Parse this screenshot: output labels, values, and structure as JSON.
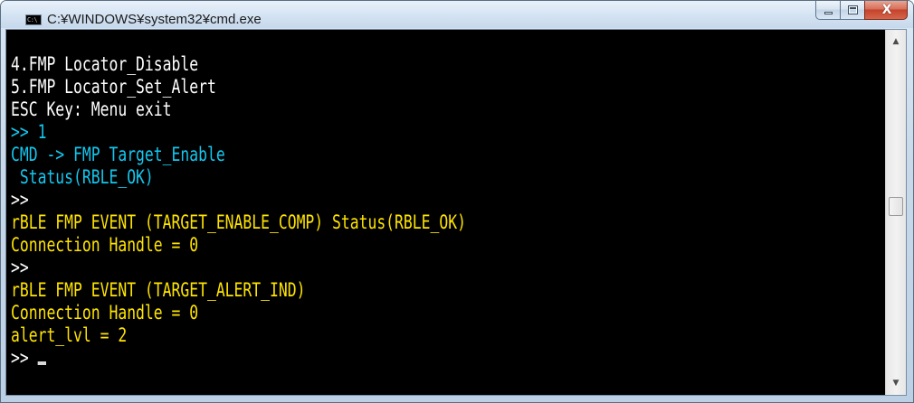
{
  "window": {
    "title": "C:¥WINDOWS¥system32¥cmd.exe",
    "icon": "cmd-console-icon",
    "icon_text": "C:\\",
    "controls": {
      "minimize_icon": "minimize-icon",
      "maximize_icon": "maximize-icon",
      "close_icon": "close-icon",
      "close_label": "X"
    }
  },
  "colors": {
    "background": "#000000",
    "white": "#ffffff",
    "cyan": "#13c8f0",
    "yellow": "#ffe400"
  },
  "console": {
    "lines": [
      {
        "text": "4.FMP Locator_Disable",
        "color": "white"
      },
      {
        "text": "5.FMP Locator_Set_Alert",
        "color": "white"
      },
      {
        "text": "ESC Key: Menu exit",
        "color": "white"
      },
      {
        "text": ">> 1",
        "color": "cyan"
      },
      {
        "text": "CMD -> FMP Target_Enable",
        "color": "cyan"
      },
      {
        "text": " Status(RBLE_OK)",
        "color": "cyan"
      },
      {
        "text": ">>",
        "color": "white"
      },
      {
        "text": "rBLE FMP EVENT (TARGET_ENABLE_COMP) Status(RBLE_OK)",
        "color": "yellow"
      },
      {
        "text": "Connection Handle = 0",
        "color": "yellow"
      },
      {
        "text": ">>",
        "color": "white"
      },
      {
        "text": "rBLE FMP EVENT (TARGET_ALERT_IND)",
        "color": "yellow"
      },
      {
        "text": "Connection Handle = 0",
        "color": "yellow"
      },
      {
        "text": "alert_lvl = 2",
        "color": "yellow"
      },
      {
        "text": ">> ",
        "color": "white",
        "cursor": true
      }
    ]
  },
  "scrollbar": {
    "up_icon": "scroll-up-arrow-icon",
    "down_icon": "scroll-down-arrow-icon",
    "up_glyph": "▲",
    "down_glyph": "▼"
  }
}
